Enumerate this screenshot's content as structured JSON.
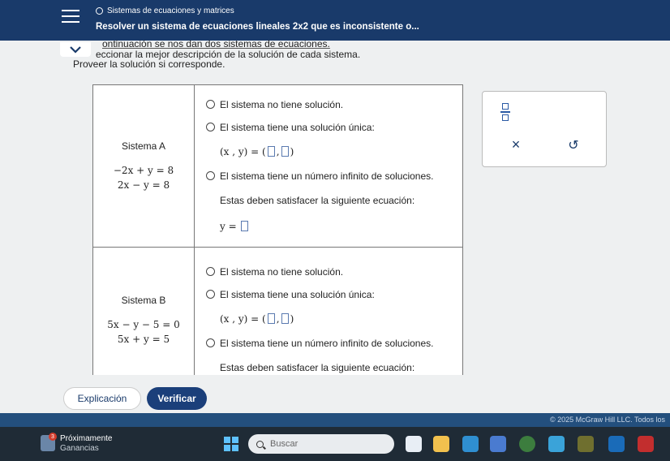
{
  "header": {
    "topic": "Sistemas de ecuaciones y matrices",
    "lesson_title": "Resolver un sistema de ecuaciones lineales 2x2 que es inconsistente o..."
  },
  "instructions": {
    "line1": "ontinuación se nos dan dos sistemas de ecuaciones.",
    "line2": "eccionar la mejor descripción de la solución de cada sistema.",
    "line3": "Proveer la solución si corresponde."
  },
  "system_a": {
    "name": "Sistema A",
    "eq1": "−2x + y = 8",
    "eq2": "2x − y = 8",
    "opt_none": "El sistema no tiene solución.",
    "opt_unique": "El sistema tiene una solución única:",
    "unique_expr": "(x , y) =",
    "opt_infinite": "El sistema tiene un número infinito de soluciones.",
    "infinite_note": "Estas deben satisfacer la siguiente ecuación:",
    "infinite_expr": "y ="
  },
  "system_b": {
    "name": "Sistema B",
    "eq1": "5x − y − 5 = 0",
    "eq2": "5x + y = 5",
    "opt_none": "El sistema no tiene solución.",
    "opt_unique": "El sistema tiene una solución única:",
    "unique_expr": "(x , y) =",
    "opt_infinite": "El sistema tiene un número infinito de soluciones.",
    "infinite_note": "Estas deben satisfacer la siguiente ecuación:"
  },
  "tools": {
    "clear_symbol": "×",
    "undo_symbol": "↺"
  },
  "footer": {
    "explain_label": "Explicación",
    "verify_label": "Verificar",
    "copyright": "© 2025 McGraw Hill LLC. Todos los"
  },
  "taskbar": {
    "badge": "3",
    "weather_title": "Próximamente",
    "weather_sub": "Ganancias",
    "search_placeholder": "Buscar"
  }
}
